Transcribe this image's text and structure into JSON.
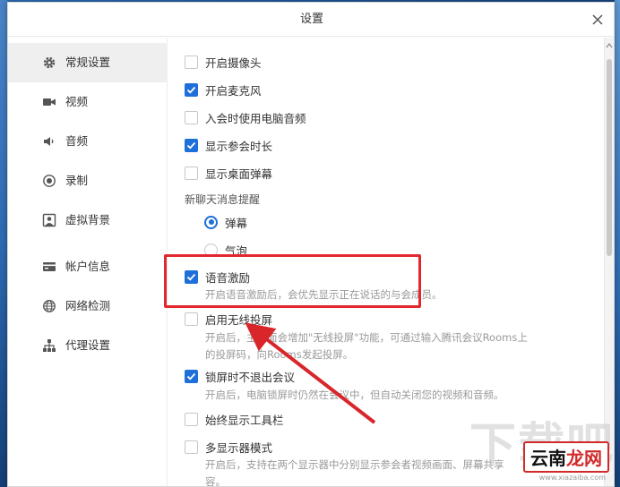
{
  "window": {
    "title": "设置"
  },
  "sidebar": {
    "items": [
      {
        "label": "常规设置",
        "icon": "gear-icon",
        "active": true
      },
      {
        "label": "视频",
        "icon": "video-camera-icon"
      },
      {
        "label": "音频",
        "icon": "speaker-icon"
      },
      {
        "label": "录制",
        "icon": "record-icon"
      },
      {
        "label": "虚拟背景",
        "icon": "person-background-icon"
      },
      {
        "label": "帐户信息",
        "icon": "card-icon"
      },
      {
        "label": "网络检测",
        "icon": "globe-icon"
      },
      {
        "label": "代理设置",
        "icon": "network-tree-icon"
      }
    ]
  },
  "settings": {
    "camera": {
      "label": "开启摄像头",
      "checked": false
    },
    "mic": {
      "label": "开启麦克风",
      "checked": true
    },
    "pc_audio": {
      "label": "入会时使用电脑音频",
      "checked": false
    },
    "show_duration": {
      "label": "显示参会时长",
      "checked": true
    },
    "desktop_popup": {
      "label": "显示桌面弹幕",
      "checked": false
    },
    "chat_reminder": {
      "label": "新聊天消息提醒",
      "options": [
        {
          "label": "弹幕",
          "selected": true
        },
        {
          "label": "气泡",
          "selected": false
        }
      ]
    },
    "voice_motivation": {
      "label": "语音激励",
      "checked": true,
      "desc": "开启语音激励后，会优先显示正在说话的与会成员。"
    },
    "wireless_cast": {
      "label": "启用无线投屏",
      "checked": false,
      "desc1": "开启后，主界面会增加\"无线投屏\"功能，可通过输入腾讯会议Rooms上",
      "desc2": "的投屏码，向Rooms发起投屏。"
    },
    "lock_screen": {
      "label": "锁屏时不退出会议",
      "checked": true,
      "desc": "开启后，电脑锁屏时仍然在会议中，但自动关闭您的视频和音频。"
    },
    "toolbar": {
      "label": "始终显示工具栏",
      "checked": false
    },
    "multi_display": {
      "label": "多显示器模式",
      "checked": false,
      "desc1": "开启后，支持在两个显示器中分别显示参会者视频画面、屏幕共享",
      "desc2": "容。"
    }
  },
  "watermark": {
    "big": "下载吧",
    "badge_a": "云南",
    "badge_b": "龙网",
    "url": "www.xiazaiba.com"
  },
  "colors": {
    "accent": "#1e6fd9",
    "highlight": "#e0282d"
  }
}
